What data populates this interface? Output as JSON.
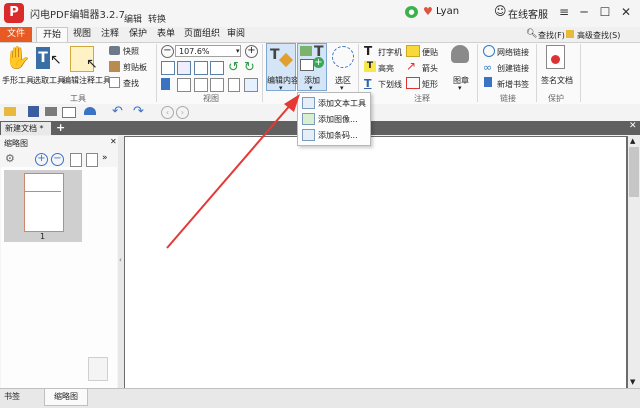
{
  "app": {
    "title": "闪电PDF编辑器3.2.7",
    "menu": [
      "编辑",
      "转换"
    ],
    "user": "Lyan",
    "support": "在线客服"
  },
  "tabs": [
    "文件",
    "开始",
    "视图",
    "注释",
    "保护",
    "表单",
    "页面组织",
    "审阅"
  ],
  "search": {
    "find": "查找(F)",
    "advanced": "高级查找(S)"
  },
  "ribbon": {
    "tools": {
      "hand": "手形工具",
      "select": "选取工具",
      "edit_annot": "编辑注释工具",
      "snapshot": "快照",
      "clipboard": "剪贴板",
      "find": "查找",
      "group": "工具"
    },
    "view": {
      "zoom": "107.6%",
      "group": "视图"
    },
    "edit": {
      "edit_content": "编辑内容",
      "add": "添加",
      "select_area": "选区"
    },
    "annot": {
      "typewriter": "打字机",
      "note": "便贴",
      "highlight": "高亮",
      "arrow": "箭头",
      "underline": "下划线",
      "rect": "矩形",
      "stamp": "图章",
      "group": "注释"
    },
    "link": {
      "weblink": "网络链接",
      "create_link": "创建链接",
      "new_bookmark": "新增书签",
      "group": "链接"
    },
    "protect": {
      "sign": "签名文档",
      "group": "保护"
    }
  },
  "doc_tab": "新建文档 *",
  "left_panel": {
    "title": "缩略图",
    "page_number": "1"
  },
  "bottom_tabs": [
    "书签",
    "缩略图"
  ],
  "dropdown": [
    "添加文本工具",
    "添加图像...",
    "添加条码..."
  ],
  "colors": {
    "file_tab": "#e85a23",
    "arrow": "#e53935",
    "logo": "#d92b2b"
  }
}
